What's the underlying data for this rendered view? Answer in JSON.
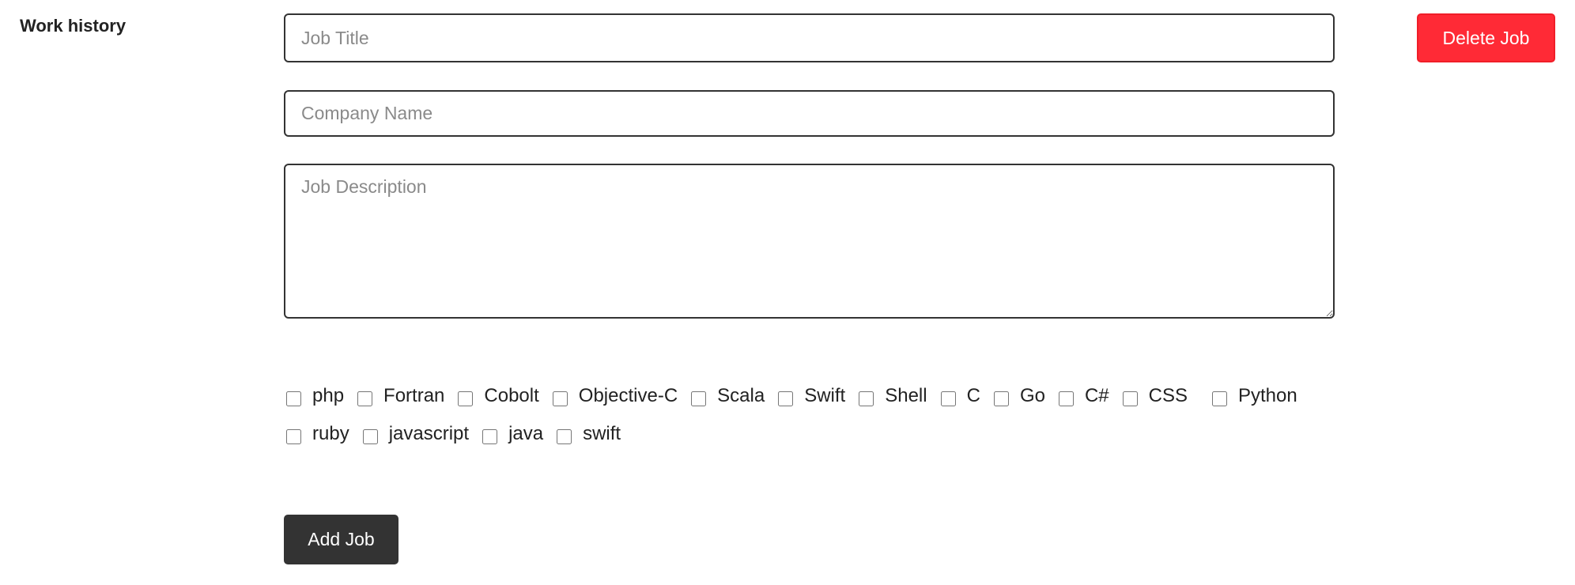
{
  "section_label": "Work history",
  "fields": {
    "job_title_placeholder": "Job Title",
    "company_name_placeholder": "Company Name",
    "job_description_placeholder": "Job Description"
  },
  "buttons": {
    "delete_job": "Delete Job",
    "add_job": "Add Job"
  },
  "languages": [
    {
      "label": "php",
      "checked": false
    },
    {
      "label": "Fortran",
      "checked": false
    },
    {
      "label": "Cobolt",
      "checked": false
    },
    {
      "label": "Objective-C",
      "checked": false
    },
    {
      "label": "Scala",
      "checked": false
    },
    {
      "label": "Swift",
      "checked": false
    },
    {
      "label": "Shell",
      "checked": false
    },
    {
      "label": "C",
      "checked": false
    },
    {
      "label": "Go",
      "checked": false
    },
    {
      "label": "C#",
      "checked": false
    },
    {
      "label": "CSS",
      "checked": false
    },
    {
      "label": "Python",
      "checked": false
    },
    {
      "label": "ruby",
      "checked": false
    },
    {
      "label": "javascript",
      "checked": false
    },
    {
      "label": "java",
      "checked": false
    },
    {
      "label": "swift",
      "checked": false
    }
  ],
  "colors": {
    "delete": "#ff2a36",
    "add": "#333333"
  }
}
